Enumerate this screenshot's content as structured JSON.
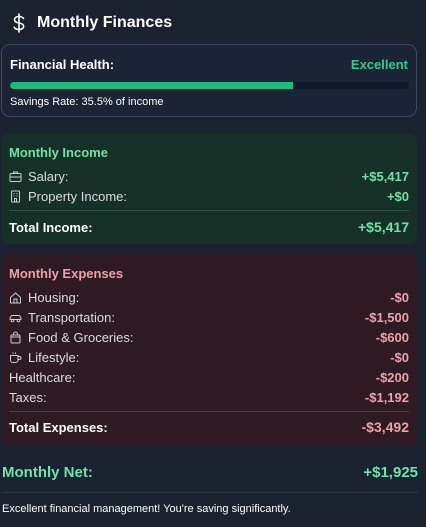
{
  "header": {
    "title": "Monthly Finances",
    "icon": "dollar-icon"
  },
  "health": {
    "label": "Financial Health:",
    "status": "Excellent",
    "status_color": "#34c98e",
    "progress_fraction": 0.71,
    "savings_rate_text": "Savings Rate: 35.5% of income"
  },
  "income": {
    "title": "Monthly Income",
    "items": [
      {
        "icon": "briefcase-icon",
        "label": "Salary:",
        "value": "+$5,417"
      },
      {
        "icon": "building-icon",
        "label": "Property Income:",
        "value": "+$0"
      }
    ],
    "total_label": "Total Income:",
    "total_value": "+$5,417"
  },
  "expenses": {
    "title": "Monthly Expenses",
    "items": [
      {
        "icon": "home-icon",
        "label": "Housing:",
        "value": "-$0"
      },
      {
        "icon": "car-icon",
        "label": "Transportation:",
        "value": "-$1,500"
      },
      {
        "icon": "shopping-bag-icon",
        "label": "Food & Groceries:",
        "value": "-$600"
      },
      {
        "icon": "coffee-icon",
        "label": "Lifestyle:",
        "value": "-$0"
      },
      {
        "icon": "",
        "label": "Healthcare:",
        "value": "-$200"
      },
      {
        "icon": "",
        "label": "Taxes:",
        "value": "-$1,192"
      }
    ],
    "total_label": "Total Expenses:",
    "total_value": "-$3,492"
  },
  "net": {
    "label": "Monthly Net:",
    "value": "+$1,925"
  },
  "message": "Excellent financial management! You're saving significantly.",
  "colors": {
    "income_green": "#6fe3a8",
    "expense_pink": "#f0a0a8",
    "progress_green": "#22b77c"
  }
}
